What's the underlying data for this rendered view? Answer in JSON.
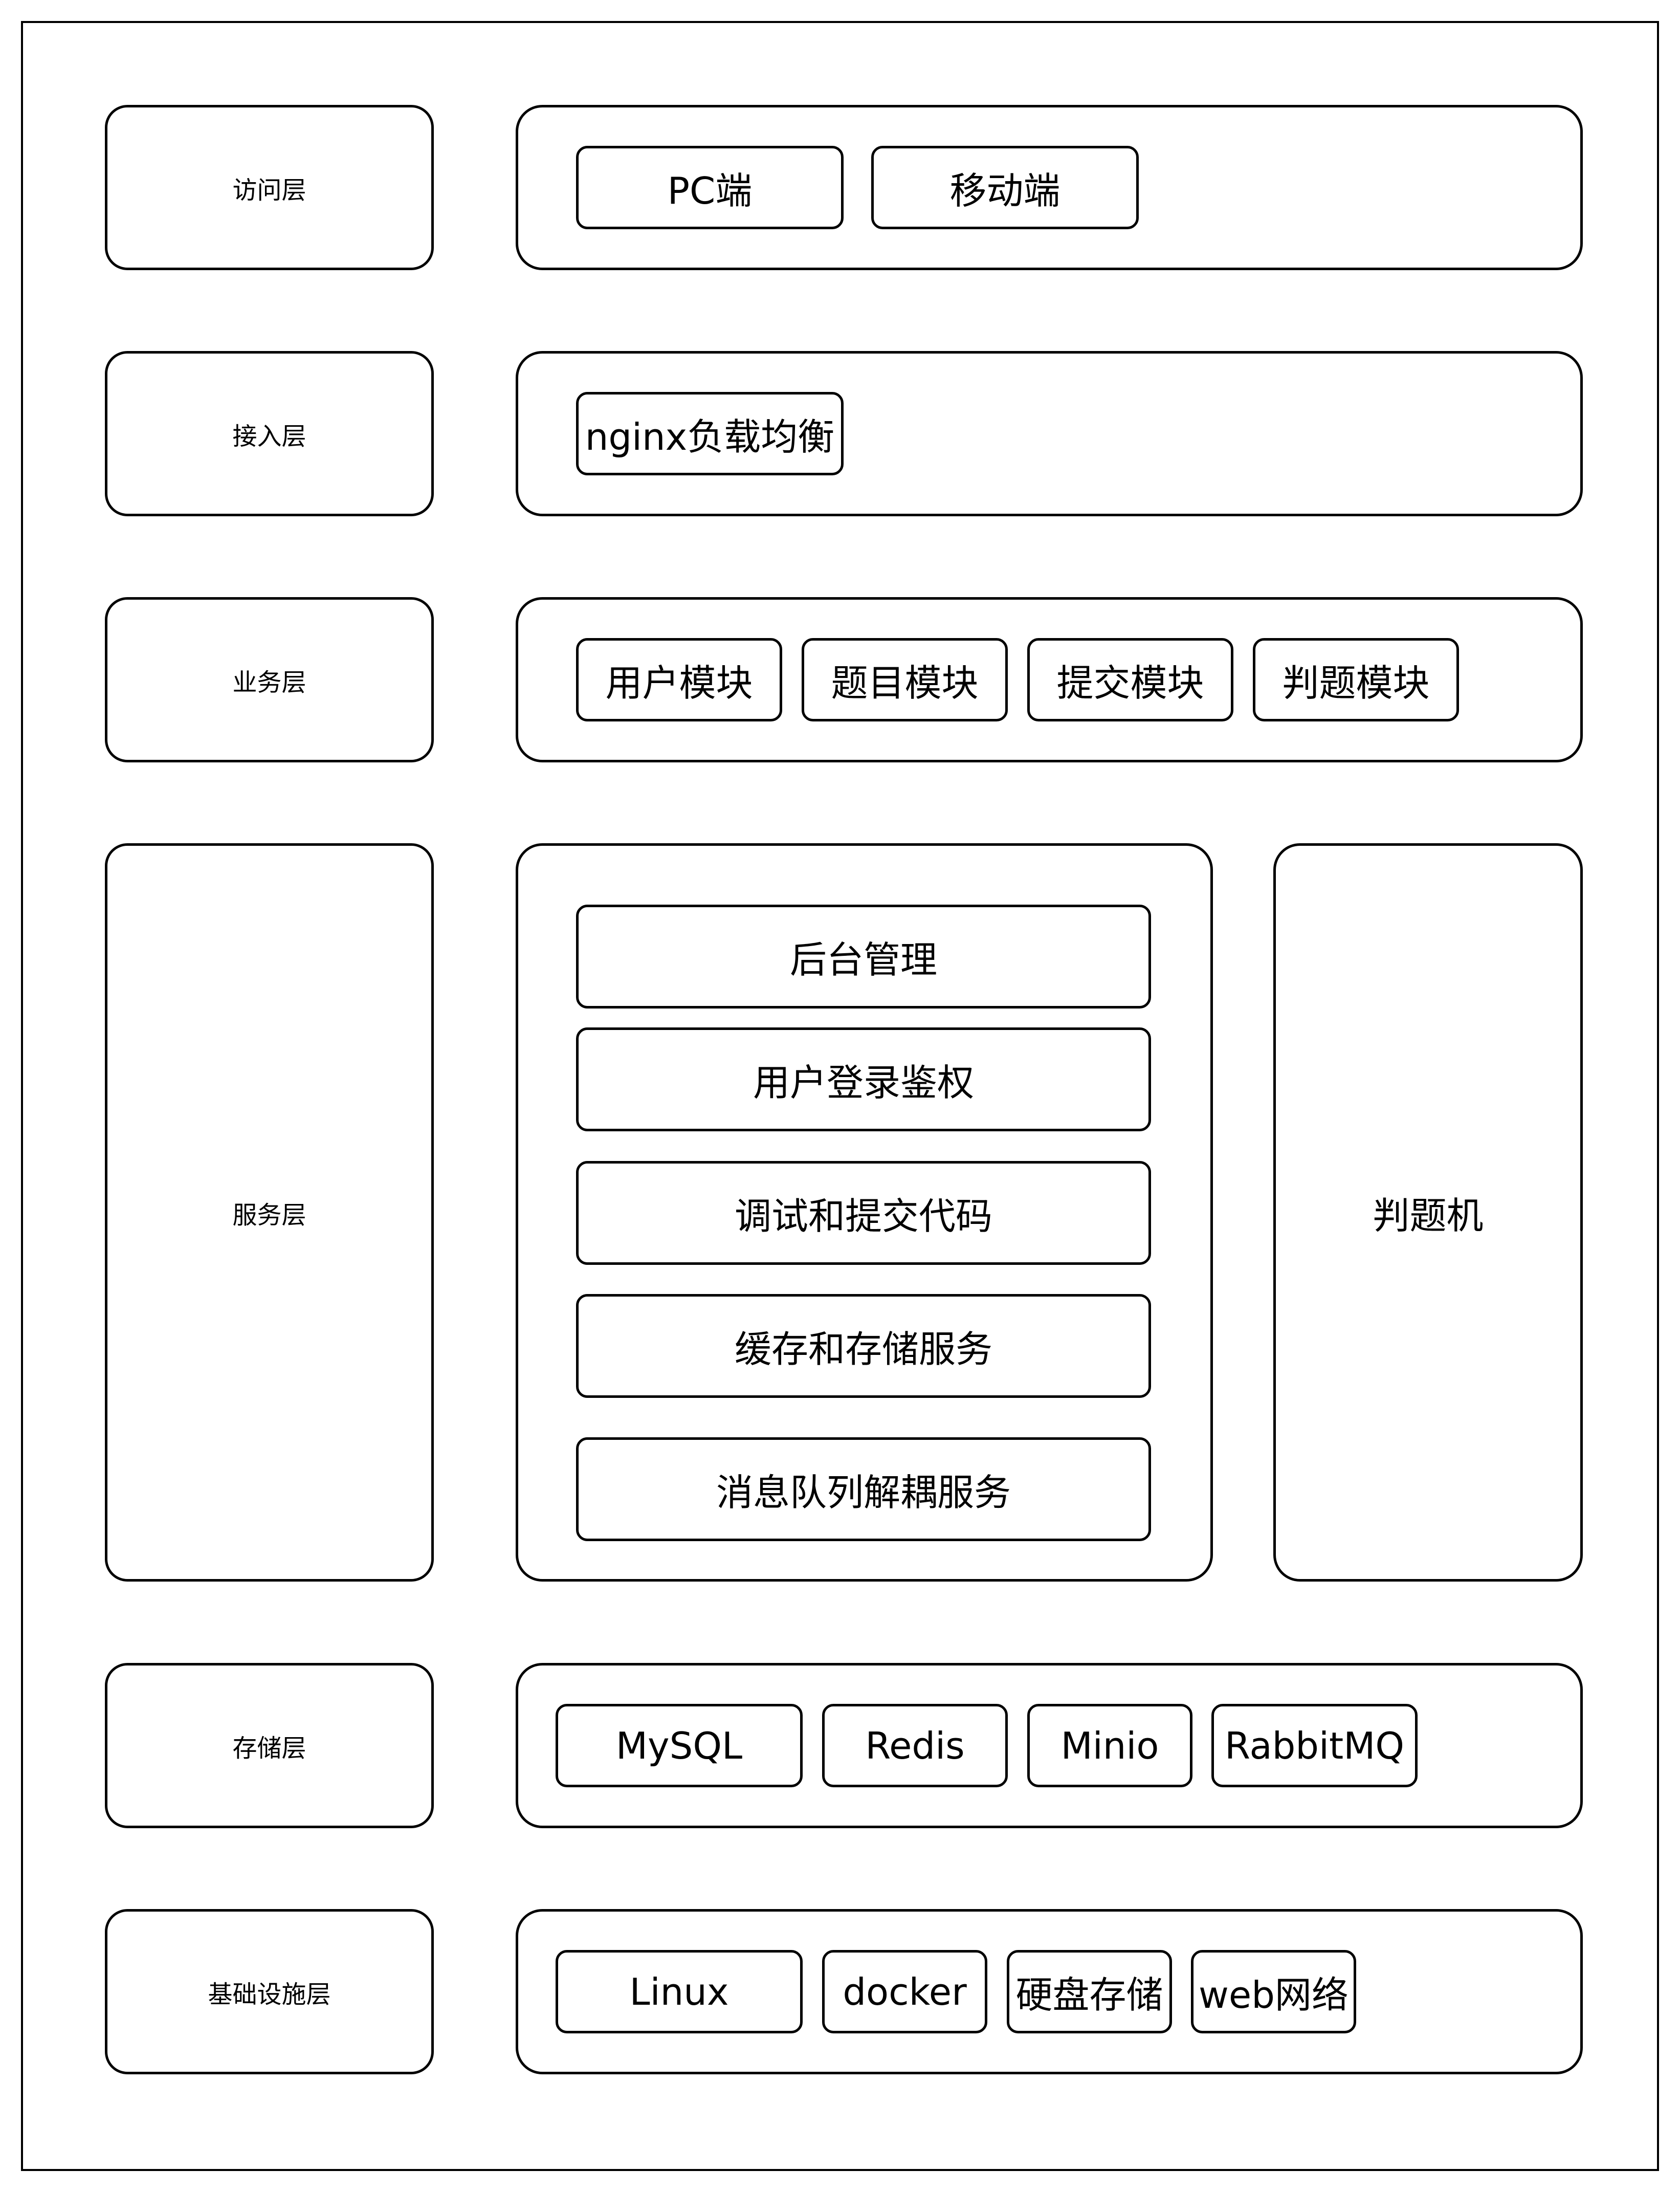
{
  "layers": [
    {
      "label": "访问层",
      "items": [
        "PC端",
        "移动端"
      ]
    },
    {
      "label": "接入层",
      "items": [
        "nginx负载均衡"
      ]
    },
    {
      "label": "业务层",
      "items": [
        "用户模块",
        "题目模块",
        "提交模块",
        "判题模块"
      ]
    },
    {
      "label": "服务层",
      "items": [
        "后台管理",
        "用户登录鉴权",
        "调试和提交代码",
        "缓存和存储服务",
        "消息队列解耦服务"
      ],
      "side": "判题机"
    },
    {
      "label": "存储层",
      "items": [
        "MySQL",
        "Redis",
        "Minio",
        "RabbitMQ"
      ]
    },
    {
      "label": "基础设施层",
      "items": [
        "Linux",
        "docker",
        "硬盘存储",
        "web网络"
      ]
    }
  ]
}
